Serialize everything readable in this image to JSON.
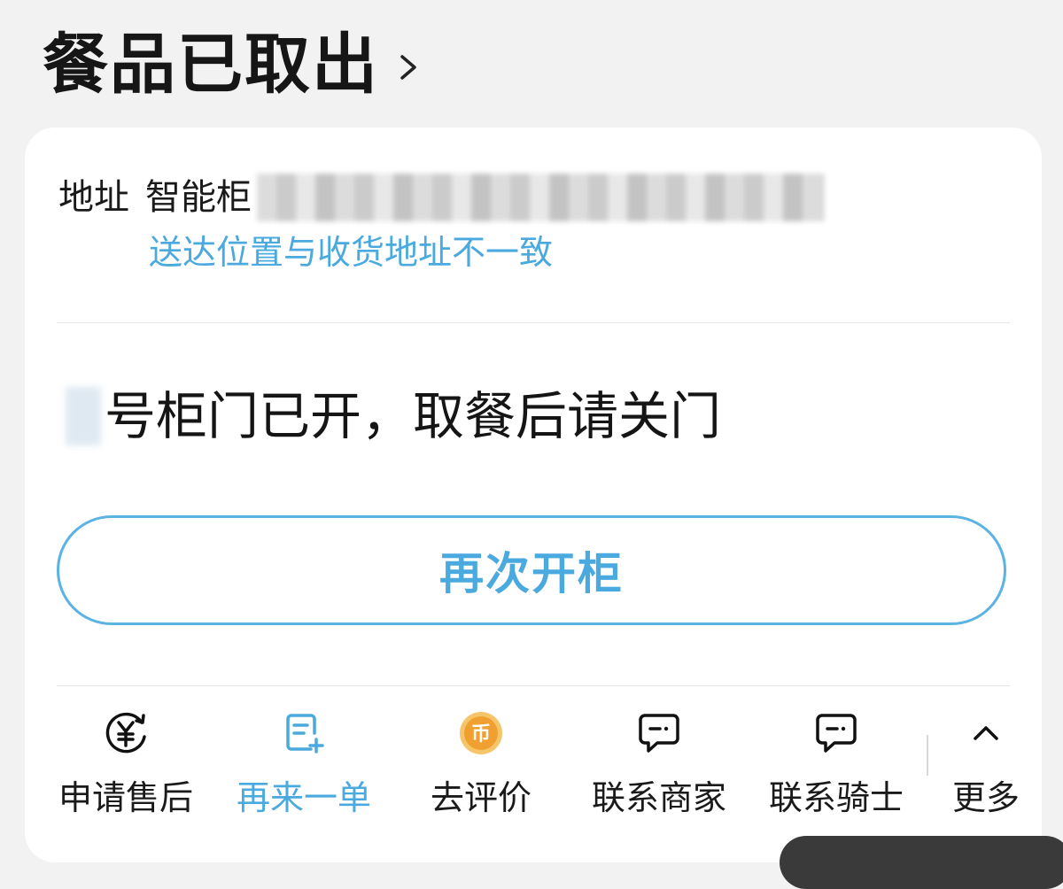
{
  "header": {
    "title": "餐品已取出",
    "chevron_icon": "chevron-right-icon"
  },
  "address": {
    "label": "地址",
    "value": "智能柜",
    "warning": "送达位置与收货地址不一致"
  },
  "locker": {
    "message": "号柜门已开，取餐后请关门"
  },
  "reopen_button": {
    "label": "再次开柜"
  },
  "actions": [
    {
      "label": "申请售后",
      "icon": "refund-yuan-icon"
    },
    {
      "label": "再来一单",
      "icon": "reorder-document-icon",
      "color": "#4aa9de"
    },
    {
      "label": "去评价",
      "icon": "coin-icon",
      "color": "#f0a030"
    },
    {
      "label": "联系商家",
      "icon": "chat-bubble-icon"
    },
    {
      "label": "联系骑士",
      "icon": "chat-bubble-icon"
    }
  ],
  "more": {
    "label": "更多",
    "icon": "chevron-up-icon"
  },
  "colors": {
    "accent": "#4aa9de",
    "coin": "#f0a030",
    "background": "#f2f2f2"
  }
}
